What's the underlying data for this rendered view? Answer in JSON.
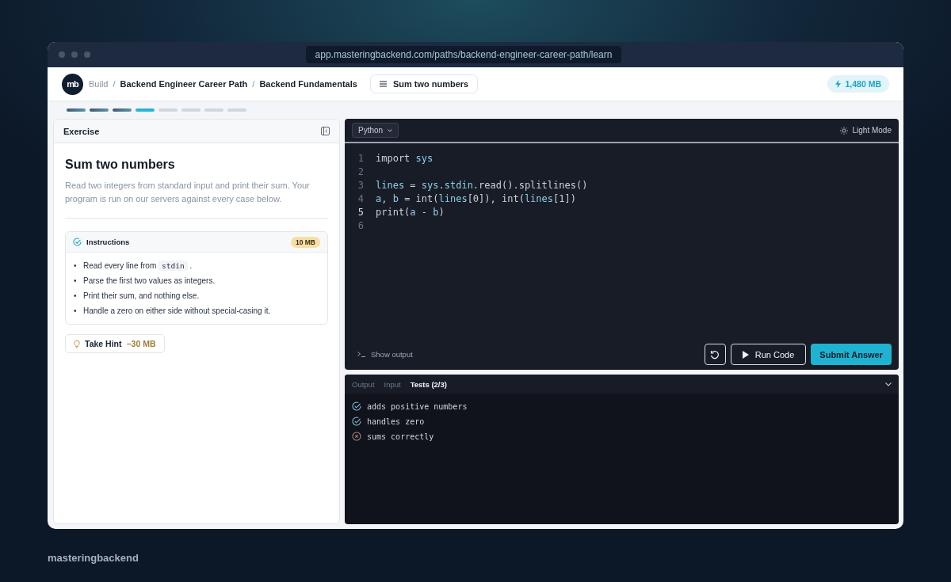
{
  "browser": {
    "url": "app.masteringbackend.com/paths/backend-engineer-career-path/learn"
  },
  "header": {
    "logo": "mb",
    "breadcrumb": [
      {
        "label": "Build",
        "muted": true
      },
      {
        "separator": "/",
        "label": "Backend Engineer Career Path",
        "muted": false
      },
      {
        "separator": "/",
        "label": "Backend Fundamentals",
        "muted": false
      }
    ],
    "lesson_button": "Sum two numbers",
    "balance": "1,480 MB"
  },
  "progress": [
    {
      "done": true,
      "current": false
    },
    {
      "done": true,
      "current": false
    },
    {
      "done": true,
      "current": false
    },
    {
      "done": false,
      "current": true
    },
    {
      "done": false,
      "current": false
    },
    {
      "done": false,
      "current": false
    },
    {
      "done": false,
      "current": false
    },
    {
      "done": false,
      "current": false
    }
  ],
  "exercise": {
    "panel_title": "Exercise",
    "title": "Sum two numbers",
    "description": "Read two integers from standard input and print their sum. Your program is run on our servers against every case below.",
    "instructions": {
      "title": "Instructions",
      "badge": "10 MB",
      "items": [
        {
          "bullet": "•",
          "parts": [
            {
              "text": "Read every line from "
            },
            {
              "text": "stdin",
              "kind": "code"
            },
            {
              "text": " ."
            }
          ]
        },
        {
          "bullet": "•",
          "parts": [
            {
              "text": "Parse the first two values as integers."
            }
          ]
        },
        {
          "bullet": "•",
          "parts": [
            {
              "text": "Print their sum, and nothing else."
            }
          ]
        },
        {
          "bullet": "•",
          "parts": [
            {
              "text": "Handle a zero on either side without special-casing it."
            }
          ]
        }
      ]
    },
    "hint": {
      "label": "Take Hint",
      "cost": "−30 MB"
    }
  },
  "editor": {
    "language": "Python",
    "theme_toggle": "Light Mode",
    "lines": [
      {
        "number": "1",
        "active": false,
        "tokens": [
          {
            "text": "import ",
            "kind": "keyword"
          },
          {
            "text": "sys",
            "kind": "name"
          }
        ]
      },
      {
        "number": "2",
        "active": false
      },
      {
        "number": "3",
        "active": false,
        "tokens": [
          {
            "text": "lines",
            "kind": "name"
          },
          {
            "text": " = ",
            "kind": "plain"
          },
          {
            "text": "sys",
            "kind": "name"
          },
          {
            "text": ".",
            "kind": "plain"
          },
          {
            "text": "stdin",
            "kind": "name"
          },
          {
            "text": ".read().splitlines()",
            "kind": "plain"
          }
        ]
      },
      {
        "number": "4",
        "active": false,
        "tokens": [
          {
            "text": "a",
            "kind": "name"
          },
          {
            "text": ", ",
            "kind": "plain"
          },
          {
            "text": "b",
            "kind": "name"
          },
          {
            "text": " = int(",
            "kind": "plain"
          },
          {
            "text": "lines",
            "kind": "name"
          },
          {
            "text": "[0]), int(",
            "kind": "plain"
          },
          {
            "text": "lines",
            "kind": "name"
          },
          {
            "text": "[1])",
            "kind": "plain"
          }
        ]
      },
      {
        "number": "5",
        "active": true,
        "tokens": [
          {
            "text": "print(",
            "kind": "plain"
          },
          {
            "text": "a",
            "kind": "name"
          },
          {
            "text": " - ",
            "kind": "plain"
          },
          {
            "text": "b",
            "kind": "name"
          },
          {
            "text": ")",
            "kind": "plain"
          }
        ]
      },
      {
        "number": "6",
        "active": false
      }
    ],
    "show_output": "Show output",
    "run_button": "Run Code",
    "submit_button": "Submit Answer"
  },
  "results": {
    "tabs": [
      {
        "label": "Output",
        "selected": false
      },
      {
        "label": "Input",
        "selected": false
      },
      {
        "label": "Tests (2/3)",
        "selected": true
      }
    ],
    "tests": [
      {
        "name": "adds positive numbers",
        "passed": true
      },
      {
        "name": "handles zero",
        "passed": true
      },
      {
        "name": "sums correctly",
        "passed": false
      }
    ]
  },
  "footer": {
    "brand": "masteringbackend"
  }
}
